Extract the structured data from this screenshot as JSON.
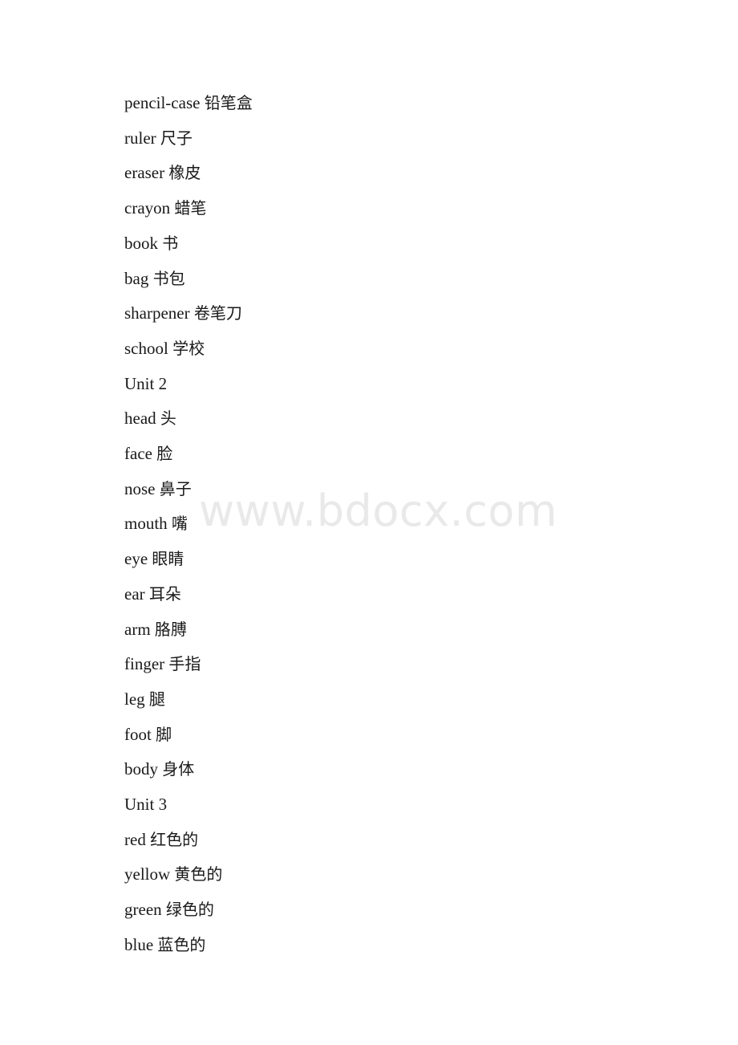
{
  "document": {
    "watermark": "www.bdocx.com",
    "background_color": "#ffffff",
    "text_color": "#1a1a1a",
    "watermark_color": "#e9e9e9"
  },
  "lines": [
    {
      "english": "pencil-case",
      "chinese": "铅笔盒"
    },
    {
      "english": "ruler",
      "chinese": "尺子"
    },
    {
      "english": "eraser",
      "chinese": "橡皮"
    },
    {
      "english": "crayon",
      "chinese": "蜡笔"
    },
    {
      "english": "book",
      "chinese": "书"
    },
    {
      "english": "bag",
      "chinese": "书包"
    },
    {
      "english": "sharpener",
      "chinese": "卷笔刀"
    },
    {
      "english": "school",
      "chinese": "学校"
    },
    {
      "english": "Unit 2",
      "chinese": ""
    },
    {
      "english": "head",
      "chinese": "头"
    },
    {
      "english": "face",
      "chinese": "脸"
    },
    {
      "english": "nose",
      "chinese": "鼻子"
    },
    {
      "english": "mouth",
      "chinese": "嘴"
    },
    {
      "english": "eye",
      "chinese": "眼睛"
    },
    {
      "english": "ear",
      "chinese": "耳朵"
    },
    {
      "english": "arm",
      "chinese": "胳膊"
    },
    {
      "english": "finger",
      "chinese": "手指"
    },
    {
      "english": "leg",
      "chinese": "腿"
    },
    {
      "english": "foot",
      "chinese": "脚"
    },
    {
      "english": "body",
      "chinese": "身体"
    },
    {
      "english": "Unit 3",
      "chinese": ""
    },
    {
      "english": "red",
      "chinese": "红色的"
    },
    {
      "english": "yellow",
      "chinese": "黄色的"
    },
    {
      "english": "green",
      "chinese": "绿色的"
    },
    {
      "english": "blue",
      "chinese": "蓝色的"
    }
  ]
}
